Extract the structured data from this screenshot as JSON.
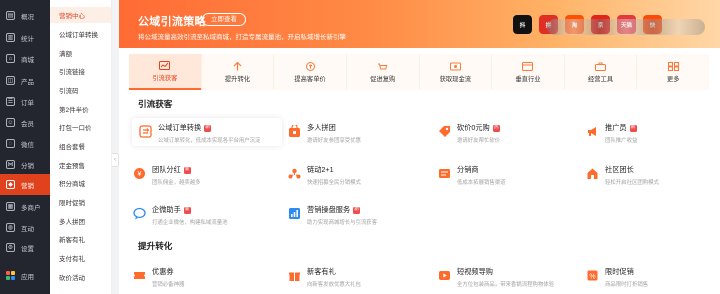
{
  "sidebar_primary": [
    {
      "label": "概况",
      "icon": "overview-icon",
      "glyph": "▤"
    },
    {
      "label": "统计",
      "icon": "stats-icon",
      "glyph": "▥"
    },
    {
      "label": "商城",
      "icon": "mall-icon",
      "glyph": "⌂"
    },
    {
      "label": "产品",
      "icon": "product-icon",
      "glyph": "◫"
    },
    {
      "label": "订单",
      "icon": "order-icon",
      "glyph": "☰"
    },
    {
      "label": "会员",
      "icon": "member-icon",
      "glyph": "☺"
    },
    {
      "label": "微信",
      "icon": "wechat-icon",
      "glyph": "◌"
    },
    {
      "label": "分销",
      "icon": "distribution-icon",
      "glyph": "⋈"
    },
    {
      "label": "营销",
      "icon": "marketing-icon",
      "glyph": "◆",
      "active": true
    },
    {
      "label": "多商户",
      "icon": "merchant-icon",
      "glyph": "▦"
    },
    {
      "label": "互动",
      "icon": "interact-icon",
      "glyph": "◍"
    },
    {
      "label": "设置",
      "icon": "settings-icon",
      "glyph": "⚙"
    },
    {
      "label": "应用",
      "icon": "apps-icon",
      "glyph": ""
    }
  ],
  "sidebar_secondary": [
    "营销中心",
    "公域订单转换",
    "满额",
    "引流链接",
    "引流码",
    "第2件半价",
    "打包一口价",
    "组合套餐",
    "定金预售",
    "积分商城",
    "限时促销",
    "多人拼团",
    "新客有礼",
    "支付有礼",
    "砍价活动"
  ],
  "banner": {
    "title": "公域引流策略",
    "button": "立即查看",
    "subtitle": "将公域流量高效引流至私域商城，打造专属流量池，开启私域增长新引擎"
  },
  "banner_logos": [
    {
      "text": "抖",
      "color": "#111111"
    },
    {
      "text": "拼",
      "color": "#e02e24"
    },
    {
      "text": "淘",
      "color": "#ff5000"
    },
    {
      "text": "京",
      "color": "#e1251b"
    },
    {
      "text": "天猫",
      "color": "#e4393c"
    },
    {
      "text": "快",
      "color": "#ff4906"
    }
  ],
  "tabs": [
    {
      "label": "引流获客",
      "icon": "traffic-icon",
      "active": true
    },
    {
      "label": "提升转化",
      "icon": "conversion-icon"
    },
    {
      "label": "提高客单价",
      "icon": "aov-icon"
    },
    {
      "label": "促进复购",
      "icon": "repurchase-icon"
    },
    {
      "label": "获取现金流",
      "icon": "cashflow-icon"
    },
    {
      "label": "垂直行业",
      "icon": "industry-icon"
    },
    {
      "label": "经营工具",
      "icon": "tools-icon"
    },
    {
      "label": "更多",
      "icon": "more-icon"
    }
  ],
  "sections": {
    "acquire": "引流获客",
    "convert": "提升转化"
  },
  "cards_acquire": [
    {
      "name": "公域订单转换",
      "badge": "新",
      "desc": "公域订单转化，低成本实现各平台用户沉淀",
      "icon": "order-convert-icon",
      "color": "#ff6b2c"
    },
    {
      "name": "多人拼团",
      "badge": "",
      "desc": "邀请好友参团享受优惠",
      "icon": "group-buy-icon",
      "color": "#ff6b2c"
    },
    {
      "name": "砍价0元购",
      "badge": "热",
      "desc": "邀请好友帮忙砍价",
      "icon": "bargain-icon",
      "color": "#ff6b2c"
    },
    {
      "name": "推广员",
      "badge": "新",
      "desc": "团队推广收益",
      "icon": "promoter-icon",
      "color": "#ff6b2c"
    },
    {
      "name": "团队分红",
      "badge": "新",
      "desc": "团队佣金，越卖越多",
      "icon": "team-bonus-icon",
      "color": "#ff6b2c"
    },
    {
      "name": "链动2+1",
      "badge": "",
      "desc": "快速招募全民分销模式",
      "icon": "link-chain-icon",
      "color": "#ff6b2c"
    },
    {
      "name": "分销商",
      "badge": "",
      "desc": "低成本拓展销售渠道",
      "icon": "distributor-icon",
      "color": "#ff6b2c"
    },
    {
      "name": "社区团长",
      "badge": "",
      "desc": "轻松开启社区团购模式",
      "icon": "community-leader-icon",
      "color": "#ff6b2c"
    },
    {
      "name": "企微助手",
      "badge": "新",
      "desc": "打通企业微信，构建私域流量池",
      "icon": "wecom-assistant-icon",
      "color": "#2d8cf0"
    },
    {
      "name": "营销操盘服务",
      "badge": "新",
      "desc": "助力实现商城增长与引流获客",
      "icon": "marketing-service-icon",
      "color": "#2d8cf0"
    }
  ],
  "cards_convert": [
    {
      "name": "优惠券",
      "badge": "",
      "desc": "营销必备神器",
      "icon": "coupon-icon",
      "color": "#ff6b2c"
    },
    {
      "name": "新客有礼",
      "badge": "",
      "desc": "向新客发放优惠大礼包",
      "icon": "new-customer-gift-icon",
      "color": "#ff6b2c"
    },
    {
      "name": "短视频导购",
      "badge": "",
      "desc": "全方位包装商品，带来香锅流程购物体验",
      "icon": "short-video-icon",
      "color": "#ff6b2c"
    },
    {
      "name": "限时促销",
      "badge": "",
      "desc": "商品限时打折销售",
      "icon": "flash-sale-icon",
      "color": "#ff6b2c"
    }
  ]
}
